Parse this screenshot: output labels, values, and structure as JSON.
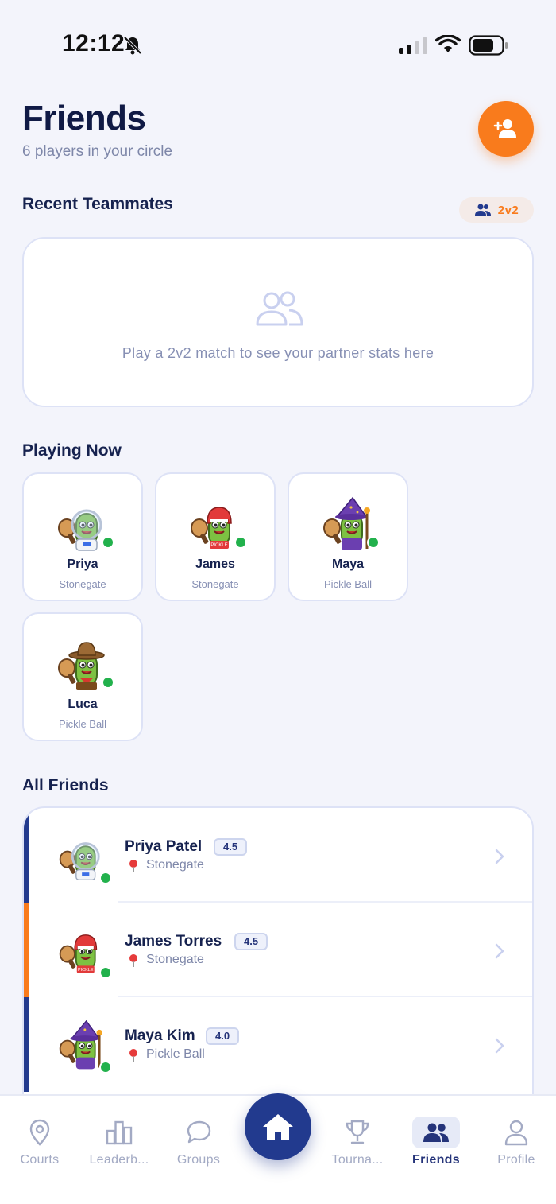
{
  "status": {
    "time": "12:12"
  },
  "header": {
    "title": "Friends",
    "subtitle": "6 players in your circle"
  },
  "teammates": {
    "title": "Recent Teammates",
    "badge": "2v2",
    "empty_message": "Play a 2v2 match to see your partner stats here"
  },
  "playing_now": {
    "title": "Playing Now",
    "players": [
      {
        "name": "Priya",
        "location": "Stonegate",
        "avatar": "astronaut"
      },
      {
        "name": "James",
        "location": "Stonegate",
        "avatar": "racer"
      },
      {
        "name": "Maya",
        "location": "Pickle Ball",
        "avatar": "wizard"
      },
      {
        "name": "Luca",
        "location": "Pickle Ball",
        "avatar": "cowboy"
      }
    ]
  },
  "all_friends": {
    "title": "All Friends",
    "friends": [
      {
        "name": "Priya Patel",
        "rating": "4.5",
        "location": "Stonegate",
        "avatar": "astronaut",
        "accent": "#223a8e"
      },
      {
        "name": "James Torres",
        "rating": "4.5",
        "location": "Stonegate",
        "avatar": "racer",
        "accent": "#f97b1c"
      },
      {
        "name": "Maya Kim",
        "rating": "4.0",
        "location": "Pickle Ball",
        "avatar": "wizard",
        "accent": "#223a8e"
      }
    ]
  },
  "nav": {
    "items": [
      {
        "label": "Courts",
        "icon": "pin-icon"
      },
      {
        "label": "Leaderb...",
        "icon": "leaderboard-icon"
      },
      {
        "label": "Groups",
        "icon": "chat-icon"
      },
      {
        "label": "Tourna...",
        "icon": "trophy-icon"
      },
      {
        "label": "Friends",
        "icon": "friends-icon",
        "active": true
      },
      {
        "label": "Profile",
        "icon": "profile-icon"
      }
    ]
  },
  "colors": {
    "accent": "#f97b1c",
    "primary": "#223a8e",
    "online": "#22b14c"
  }
}
